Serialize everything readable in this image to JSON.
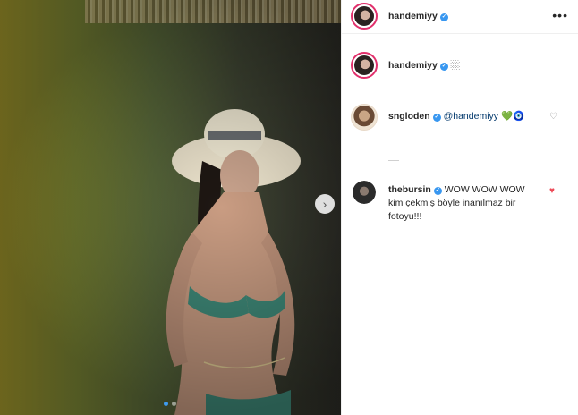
{
  "post": {
    "carousel": {
      "total_slides": 2,
      "active_slide": 1
    }
  },
  "header": {
    "username": "handemiyy",
    "more_icon": "more-horizontal-icon"
  },
  "caption": {
    "username": "handemiyy",
    "text": "🏼"
  },
  "comments": [
    {
      "username": "sngloden",
      "mention": "@handemiyy",
      "emoji": "💚🧿",
      "liked": false
    },
    {
      "username": "thebursin",
      "text_line1": "WOW WOW WOW",
      "text_line2": "kim çekmiş böyle inanılmaz bir",
      "text_line3": "fotoyu!!!",
      "liked": true
    }
  ],
  "colors": {
    "verified": "#3897f0",
    "heart_filled": "#ed4956",
    "story_ring": "#e1306c",
    "carousel_active_dot": "#3f9bf0"
  }
}
